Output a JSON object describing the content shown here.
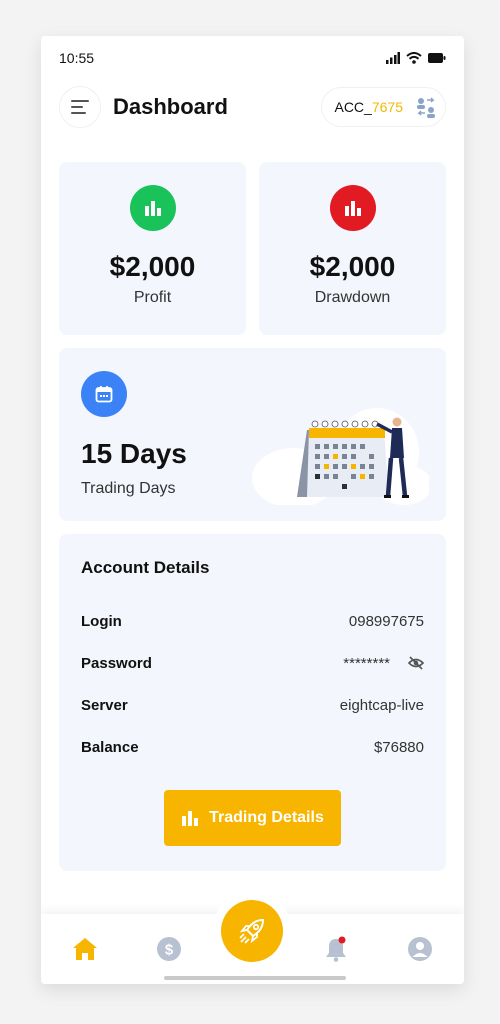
{
  "status_bar": {
    "time": "10:55"
  },
  "header": {
    "title": "Dashboard",
    "account_prefix": "ACC_",
    "account_number": "7675"
  },
  "stats": [
    {
      "value": "$2,000",
      "label": "Profit",
      "icon": "bar-chart-icon",
      "color": "#19c35a"
    },
    {
      "value": "$2,000",
      "label": "Drawdown",
      "icon": "bar-chart-icon",
      "color": "#e21b23"
    }
  ],
  "trading_days": {
    "value": "15 Days",
    "label": "Trading Days",
    "icon": "calendar-icon",
    "color": "#3b82f6"
  },
  "account_details": {
    "title": "Account Details",
    "rows": [
      {
        "key": "Login",
        "value": "098997675"
      },
      {
        "key": "Password",
        "value": "********"
      },
      {
        "key": "Server",
        "value": "eightcap-live"
      },
      {
        "key": "Balance",
        "value": "$76880"
      }
    ],
    "button_label": "Trading Details"
  },
  "bottom_nav": {
    "items": [
      "home-icon",
      "dollar-icon",
      "rocket-icon",
      "bell-icon",
      "profile-icon"
    ],
    "active": "home-icon"
  },
  "colors": {
    "accent": "#f7b500",
    "card_bg": "#f3f6fc",
    "profit": "#19c35a",
    "drawdown": "#e21b23",
    "calendar": "#3b82f6"
  }
}
